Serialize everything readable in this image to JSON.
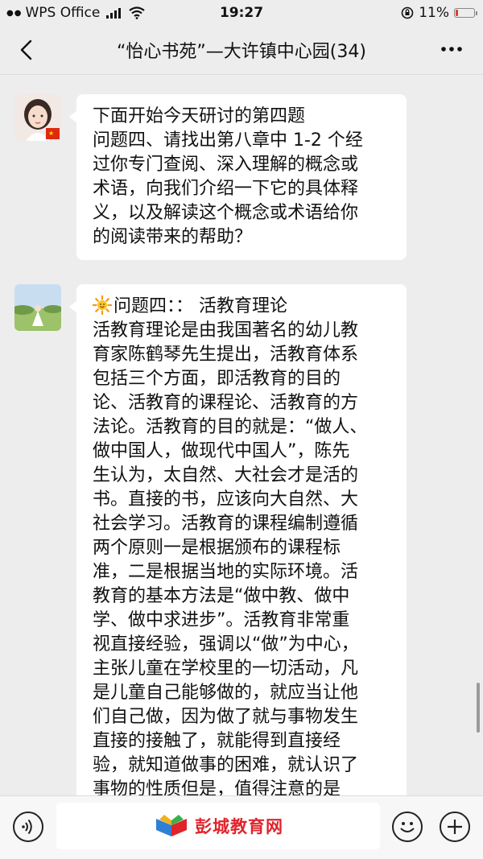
{
  "status_bar": {
    "carrier": "WPS Office",
    "time": "19:27",
    "battery": "11%"
  },
  "nav": {
    "title": "“怡心书苑”—大许镇中心园(34)"
  },
  "messages": [
    {
      "lines": [
        "下面开始今天研讨的第四题",
        "问题四、请找出第八章中 1-2 个经",
        "过你专门查阅、深入理解的概念或",
        "术语，向我们介绍一下它的具体释",
        "义，以及解读这个概念或术语给你",
        "的阅读带来的帮助？"
      ]
    },
    {
      "lines": [
        "问题四：：  活教育理论",
        "活教育理论是由我国著名的幼儿教",
        "育家陈鹤琴先生提出，活教育体系",
        "包括三个方面，即活教育的目的",
        "论、活教育的课程论、活教育的方",
        "法论。活教育的目的就是：“做人、",
        "做中国人，做现代中国人”，陈先",
        "生认为，太自然、大社会才是活的",
        "书。直接的书，应该向大自然、大",
        "社会学习。活教育的课程编制遵循",
        "两个原则一是根据颁布的课程标",
        "准，二是根据当地的实际环境。活",
        "教育的基本方法是“做中教、做中",
        "学、做中求进步”。活教育非常重",
        "视直接经验，强调以“做”为中心，",
        "主张儿童在学校里的一切活动，凡",
        "是儿童自己能够做的，就应当让他",
        "们自己做，因为做了就与事物发生",
        "直接的接触了，就能得到直接经",
        "验，就知道做事的困难，就认识了",
        "事物的性质但是，值得注意的是"
      ]
    }
  ],
  "watermark": {
    "text": "彭城教育网"
  },
  "colors": {
    "background": "#ededed",
    "bubble": "#ffffff",
    "watermark_red": "#e0242b",
    "battery_low": "#e53935"
  }
}
